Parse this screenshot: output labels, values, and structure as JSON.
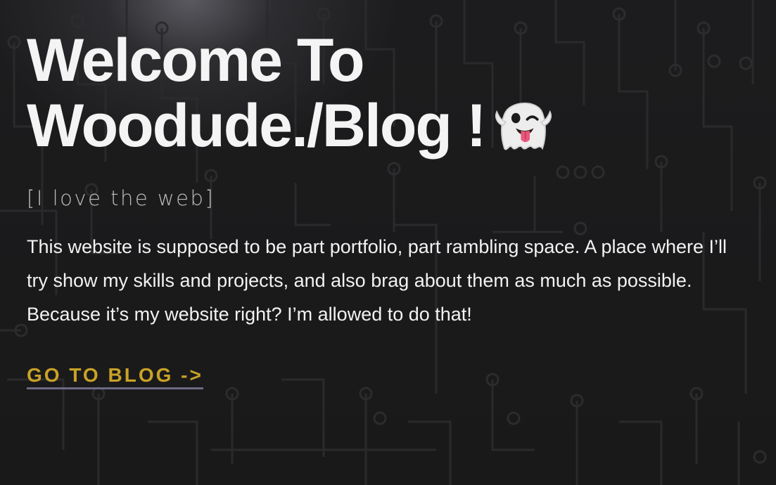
{
  "hero": {
    "title_line1": "Welcome To",
    "title_line2": "Woodude./Blog !",
    "title_icon": "ghost-emoji-icon",
    "tagline": "[I love the web]",
    "intro": "This website is supposed to be part portfolio, part rambling space. A place where I’ll try show my skills and projects, and also brag about them as much as possible. Because it’s my website right? I’m allowed to do that!",
    "cta_label": "GO TO BLOG ->"
  },
  "colors": {
    "background": "#1a1a1a",
    "title": "#f4f4f4",
    "tagline": "#bdbdbd",
    "body_text": "#f2f2f2",
    "cta": "#c9a227",
    "cta_underline": "#6b6a84"
  }
}
